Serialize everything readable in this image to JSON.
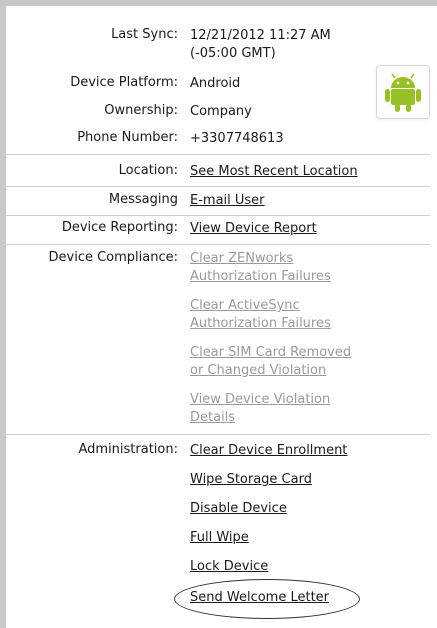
{
  "device_info": {
    "last_sync": {
      "label": "Last Sync:",
      "value_line1": "12/21/2012 11:27 AM",
      "value_line2": "(-05:00 GMT)"
    },
    "device_platform": {
      "label": "Device Platform:",
      "value": "Android"
    },
    "ownership": {
      "label": "Ownership:",
      "value": "Company"
    },
    "phone_number": {
      "label": "Phone Number:",
      "value": "+3307748613"
    }
  },
  "actions": {
    "location": {
      "label": "Location:",
      "link": "See Most Recent Location"
    },
    "messaging": {
      "label": "Messaging",
      "link": "E-mail User"
    },
    "device_reporting": {
      "label": "Device Reporting:",
      "link": "View Device Report"
    },
    "device_compliance": {
      "label": "Device Compliance:",
      "links": [
        {
          "line1": "Clear ZENworks",
          "line2": "Authorization Failures"
        },
        {
          "line1": "Clear ActiveSync",
          "line2": "Authorization Failures"
        },
        {
          "line1": "Clear SIM Card Removed",
          "line2": "or Changed Violation"
        },
        {
          "line1": "View Device Violation",
          "line2": "Details"
        }
      ]
    },
    "administration": {
      "label": "Administration:",
      "links": [
        "Clear Device Enrollment",
        "Wipe Storage Card",
        "Disable Device",
        "Full Wipe",
        "Lock Device",
        "Send Welcome Letter"
      ]
    }
  },
  "icons": {
    "platform": "android-icon"
  },
  "colors": {
    "android_green": "#97c024",
    "link_disabled": "#9a9a9a",
    "separator": "#cfcfcf"
  }
}
